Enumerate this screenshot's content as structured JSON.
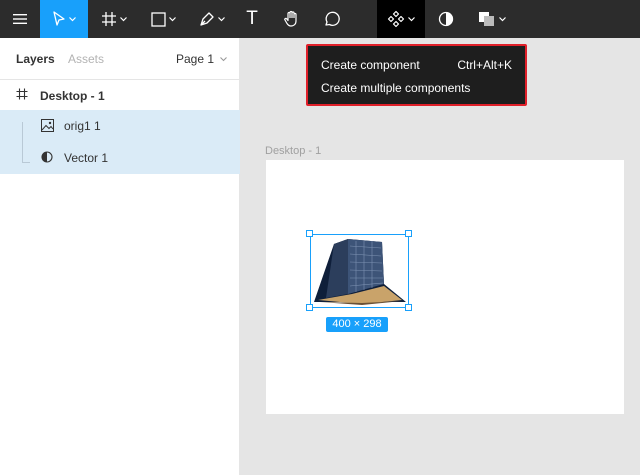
{
  "toolbar": {
    "tools": [
      {
        "name": "main-menu",
        "icon": "hamburger-icon"
      },
      {
        "name": "move-tool",
        "icon": "pointer-icon",
        "active": true
      },
      {
        "name": "frame-tool",
        "icon": "hash-icon"
      },
      {
        "name": "shape-tool",
        "icon": "square-icon"
      },
      {
        "name": "pen-tool",
        "icon": "pen-icon"
      },
      {
        "name": "text-tool",
        "icon": "text-icon"
      },
      {
        "name": "hand-tool",
        "icon": "hand-icon"
      },
      {
        "name": "comment-tool",
        "icon": "comment-icon"
      },
      {
        "name": "component-tool",
        "icon": "component-icon",
        "active": true
      },
      {
        "name": "mask-tool",
        "icon": "mask-icon"
      },
      {
        "name": "boolean-tool",
        "icon": "boolean-icon"
      }
    ],
    "text_tool_glyph": "T",
    "accent": "#18a0fb"
  },
  "panel": {
    "tab_layers": "Layers",
    "tab_assets": "Assets",
    "page_selector": "Page 1"
  },
  "layers": [
    {
      "name": "Desktop - 1",
      "icon": "frame-icon"
    },
    {
      "name": "orig1 1",
      "icon": "image-icon",
      "selected": true
    },
    {
      "name": "Vector 1",
      "icon": "mask-icon",
      "selected": true
    }
  ],
  "canvas": {
    "frame_label": "Desktop - 1",
    "size_badge": "400 × 298"
  },
  "dropdown": {
    "items": [
      {
        "label": "Create component",
        "shortcut": "Ctrl+Alt+K"
      },
      {
        "label": "Create multiple components",
        "shortcut": ""
      }
    ],
    "highlight_color": "#e0202a"
  }
}
